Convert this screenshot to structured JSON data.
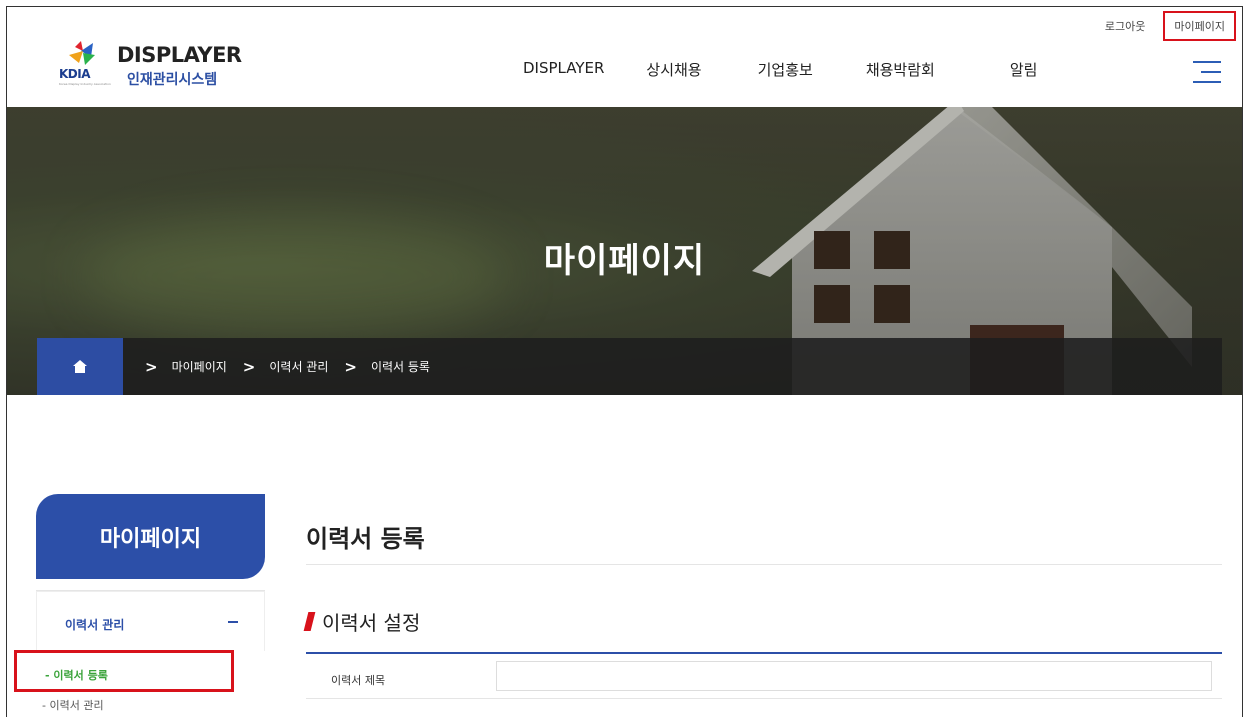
{
  "header": {
    "util": {
      "logout": "로그아웃",
      "mypage": "마이페이지"
    },
    "logo": {
      "kdia": "KDIA",
      "subtitle": "Korea Display Industry Association",
      "title": "DISPLAYER",
      "title_sub": "인재관리시스템"
    },
    "gnb": [
      "DISPLAYER",
      "상시채용",
      "기업홍보",
      "채용박람회",
      "알림"
    ],
    "menu_icon": "hamburger-menu-icon",
    "accent_color": "#2c4fa8",
    "highlight_color": "#d8121b"
  },
  "visual": {
    "title": "마이페이지"
  },
  "breadcrumb": {
    "home_icon": "home-icon",
    "items": [
      "마이페이지",
      "이력서 관리",
      "이력서 등록"
    ]
  },
  "sidebar": {
    "title": "마이페이지",
    "group": "이력서 관리",
    "items": [
      "- 이력서 등록",
      "- 이력서 관리"
    ]
  },
  "main": {
    "page_title": "이력서 등록",
    "section_title": "이력서 설정",
    "fields": [
      {
        "label": "이력서 제목",
        "value": ""
      }
    ]
  }
}
